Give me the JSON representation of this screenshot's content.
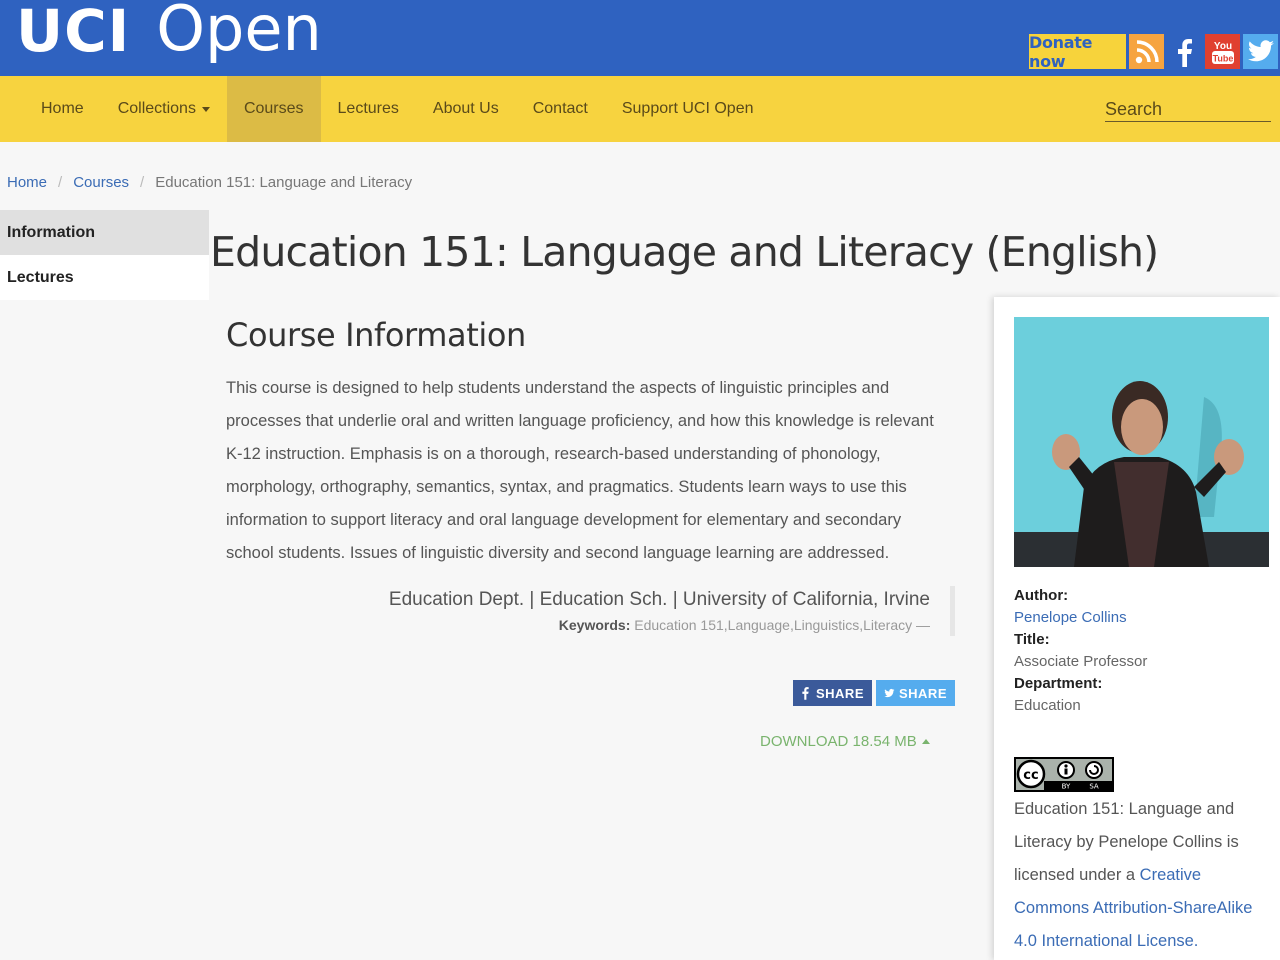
{
  "header": {
    "logo_uci": "UCI",
    "logo_open": "Open",
    "donate_label": "Donate now",
    "icons": [
      "rss-icon",
      "facebook-icon",
      "youtube-icon",
      "twitter-icon"
    ],
    "colors": {
      "brand_blue": "#2f62c0",
      "nav_yellow": "#f7d33f"
    }
  },
  "nav": {
    "items": [
      "Home",
      "Collections",
      "Courses",
      "Lectures",
      "About Us",
      "Contact",
      "Support UCI Open"
    ],
    "active": "Courses",
    "search_placeholder": "Search"
  },
  "breadcrumb": {
    "home": "Home",
    "courses": "Courses",
    "current": "Education 151: Language and Literacy"
  },
  "sidetabs": {
    "information": "Information",
    "lectures": "Lectures"
  },
  "page_title": "Education 151: Language and Literacy (English)",
  "main": {
    "section_title": "Course Information",
    "description": "This course is designed to help students understand the aspects of linguistic principles and processes that underlie oral and written language proficiency, and how this knowledge is relevant K-12 instruction.  Emphasis is on a thorough, research-based understanding of phonology, morphology, orthography, semantics, syntax, and pragmatics.  Students learn ways to use this information to support literacy and oral language development for elementary and secondary school students.  Issues of linguistic diversity and second language learning are addressed.",
    "attribution": "Education Dept. | Education Sch. | University of California, Irvine",
    "keywords_label": "Keywords:",
    "keywords": "Education 151,Language,Linguistics,Literacy —",
    "share_fb": "SHARE",
    "share_tw": "SHARE",
    "download": "DOWNLOAD 18.54 MB"
  },
  "panel": {
    "author_label": "Author:",
    "author": "Penelope Collins",
    "title_label": "Title:",
    "title": "Associate Professor",
    "department_label": "Department:",
    "department": "Education",
    "license_text_1": "Education 151: Language and Literacy by Penelope Collins is licensed under a ",
    "license_link": "Creative Commons Attribution-ShareAlike 4.0 International License.",
    "cc_badge": [
      "BY",
      "SA"
    ]
  }
}
